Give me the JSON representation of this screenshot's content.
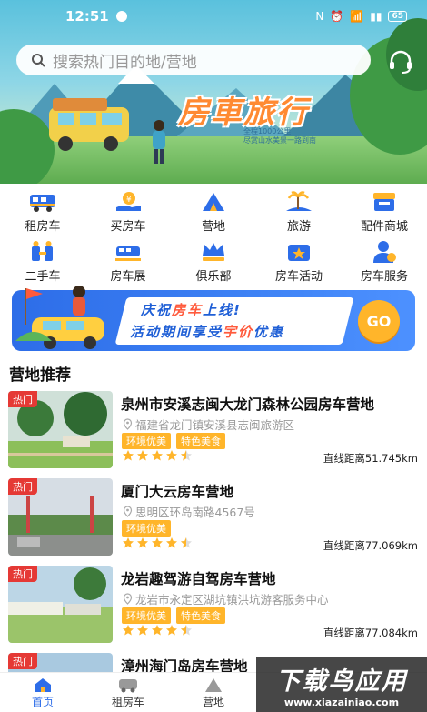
{
  "status_bar": {
    "time": "12:51",
    "battery": "65"
  },
  "search": {
    "placeholder": "搜索热门目的地/营地"
  },
  "hero": {
    "title": "房車旅行",
    "subtitle_1": "全程1000公里",
    "subtitle_2": "尽赏山水美景一路到南"
  },
  "categories": [
    {
      "label": "租房车",
      "icon": "rv-rental-icon",
      "color": "#2d6de8"
    },
    {
      "label": "买房车",
      "icon": "rv-buy-icon",
      "color": "#ffb52a"
    },
    {
      "label": "营地",
      "icon": "campsite-icon",
      "color": "#2d6de8"
    },
    {
      "label": "旅游",
      "icon": "travel-icon",
      "color": "#ffb52a"
    },
    {
      "label": "配件商城",
      "icon": "shop-icon",
      "color": "#2d6de8"
    },
    {
      "label": "二手车",
      "icon": "used-car-icon",
      "color": "#2d6de8"
    },
    {
      "label": "房车展",
      "icon": "rv-show-icon",
      "color": "#2d6de8"
    },
    {
      "label": "俱乐部",
      "icon": "club-icon",
      "color": "#2d6de8"
    },
    {
      "label": "房车活动",
      "icon": "activity-icon",
      "color": "#2d6de8"
    },
    {
      "label": "房车服务",
      "icon": "service-icon",
      "color": "#2d6de8"
    }
  ],
  "promo": {
    "line1_a": "庆祝",
    "line1_b": "房车",
    "line1_c": "上线!",
    "line2_a": "活动期间享受",
    "line2_b": "宇价",
    "line2_c": "优惠",
    "cta": "GO"
  },
  "section": {
    "title": "营地推荐"
  },
  "camps": [
    {
      "badge": "热门",
      "name": "泉州市安溪志闽大龙门森林公园房车营地",
      "address": "福建省龙门镇安溪县志闽旅游区",
      "tags": [
        "环境优美",
        "特色美食"
      ],
      "rating": 4.5,
      "distance": "直线距离51.745km"
    },
    {
      "badge": "热门",
      "name": "厦门大云房车营地",
      "address": "思明区环岛南路4567号",
      "tags": [
        "环境优美"
      ],
      "rating": 4.5,
      "distance": "直线距离77.069km"
    },
    {
      "badge": "热门",
      "name": "龙岩趣驾游自驾房车营地",
      "address": "龙岩市永定区湖坑镇洪坑游客服务中心",
      "tags": [
        "环境优美",
        "特色美食"
      ],
      "rating": 4.5,
      "distance": "直线距离77.084km"
    },
    {
      "badge": "热门",
      "name": "漳州海门岛房车营地",
      "address": "",
      "tags": [],
      "rating": 0,
      "distance": ""
    }
  ],
  "nav": [
    {
      "label": "首页",
      "icon": "home-icon"
    },
    {
      "label": "租房车",
      "icon": "rv-rental-icon"
    },
    {
      "label": "营地",
      "icon": "campsite-icon"
    }
  ],
  "watermark": {
    "big": "下载鸟应用",
    "small": "www.xiazainiao.com"
  },
  "colors": {
    "primary": "#2d6de8",
    "accent": "#ffb52a",
    "hot": "#e53935"
  }
}
